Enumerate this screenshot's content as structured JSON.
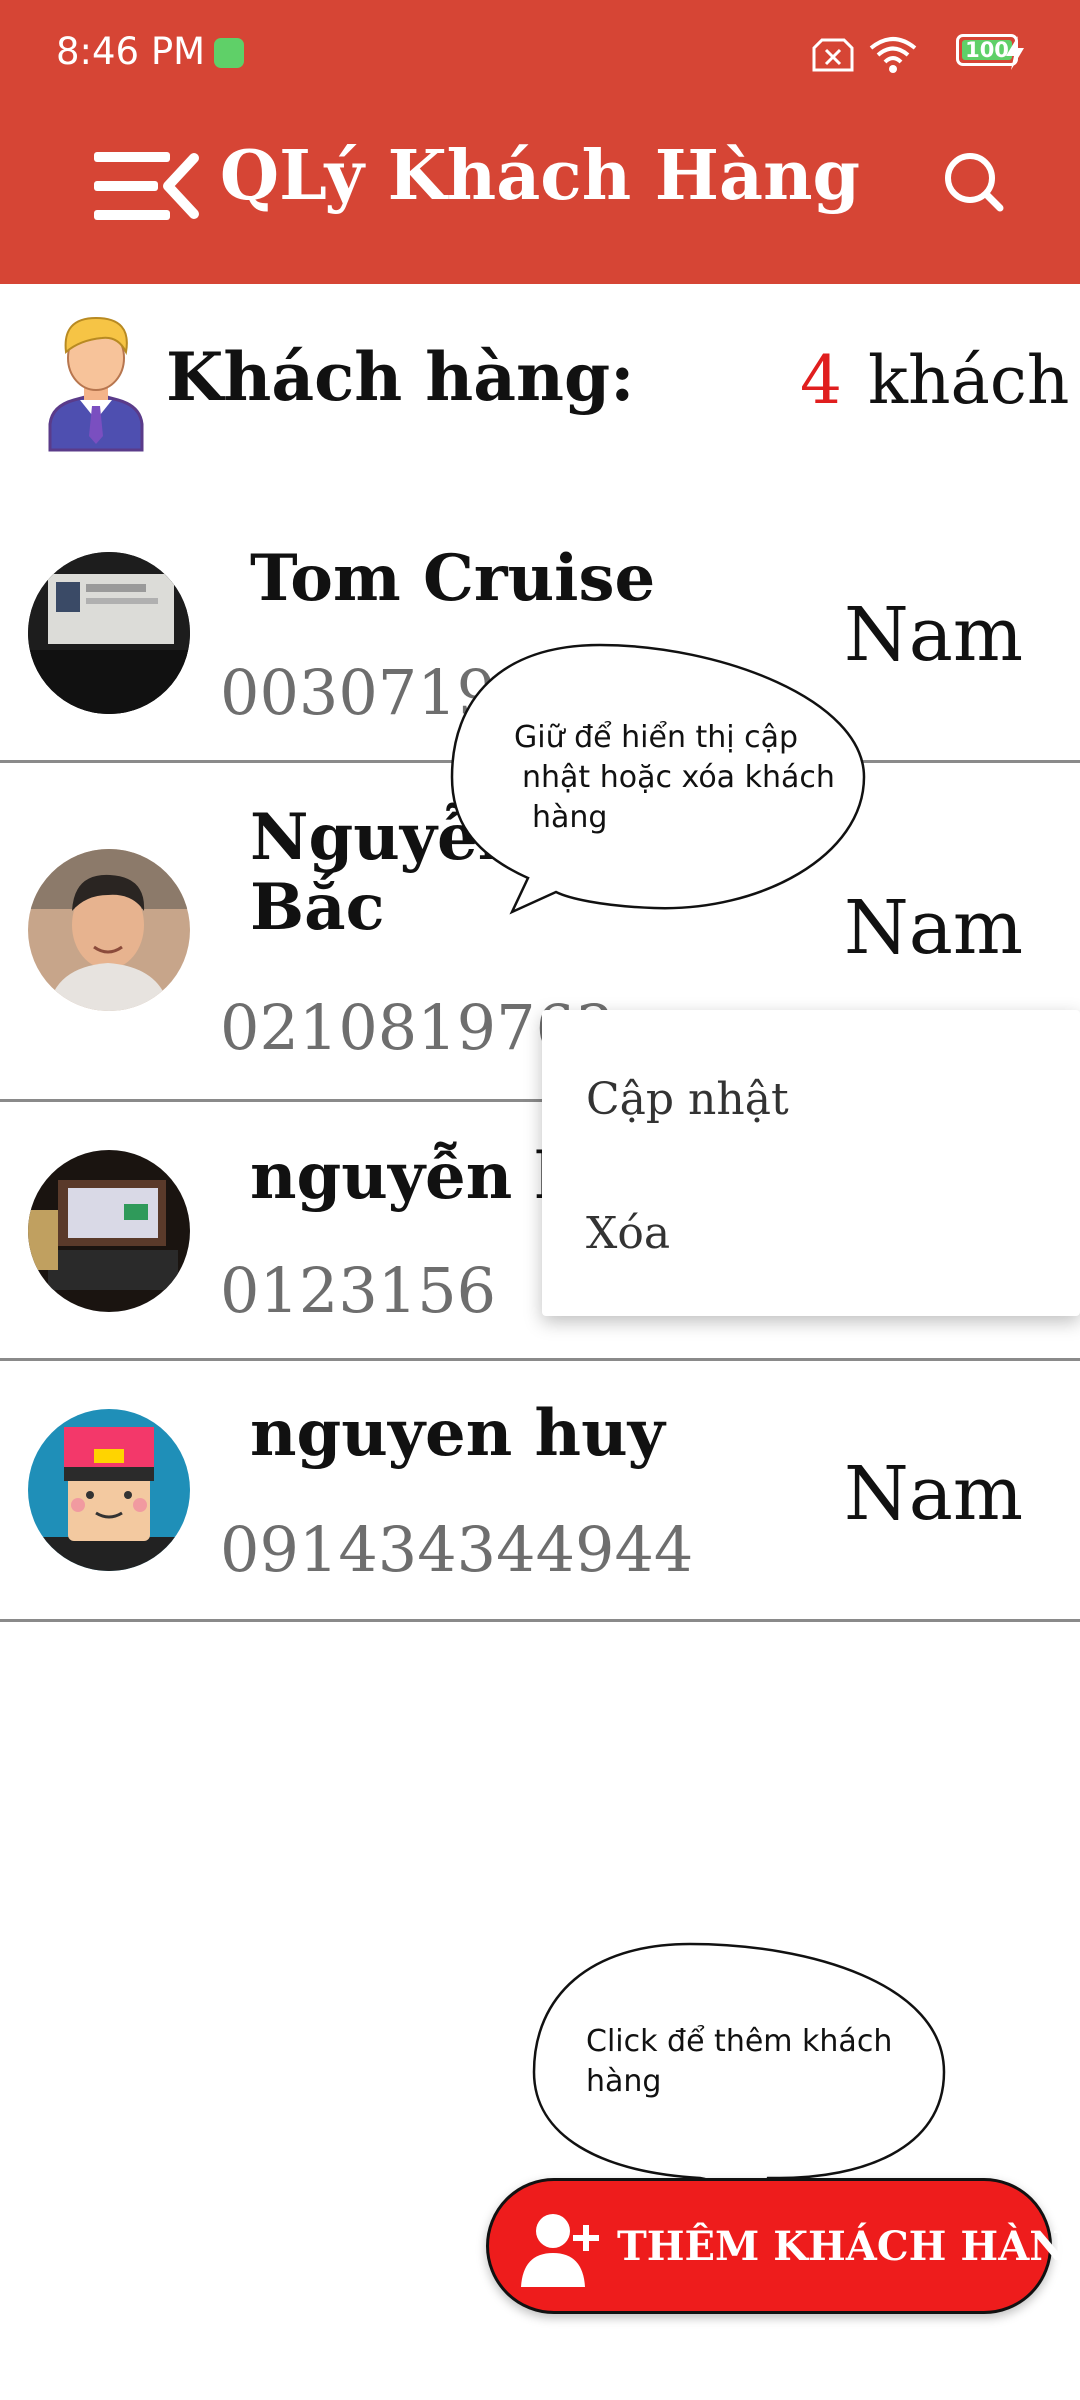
{
  "status_bar": {
    "time": "8:46 PM",
    "battery": "100",
    "icons": [
      "app-notification-icon",
      "sim-off-icon",
      "wifi-icon",
      "battery-icon",
      "charging-icon"
    ]
  },
  "app_bar": {
    "title": "QLý Khách Hàng",
    "menu_icon": "menu-collapse-icon",
    "search_icon": "search-icon",
    "background": "#d64535"
  },
  "header": {
    "label": "Khách hàng:",
    "count": "4",
    "unit": "khách",
    "count_color": "#e01e1e"
  },
  "customers": [
    {
      "name": "Tom Cruise",
      "phone": "0030719632",
      "gender": "Nam"
    },
    {
      "name": "Nguyễn Xuân Bắc",
      "name_line1": "Nguyễn",
      "name_line2": "Bắc",
      "phone": "0210819763",
      "gender": "Nam"
    },
    {
      "name": "nguyễn h",
      "phone": "0123156",
      "gender": ""
    },
    {
      "name": "nguyen huy",
      "phone": "091434344944",
      "gender": "Nam"
    }
  ],
  "context_menu": {
    "items": [
      {
        "label": "Cập nhật"
      },
      {
        "label": "Xóa"
      }
    ]
  },
  "tooltips": {
    "long_press": [
      "Giữ để hiển thị cập",
      "nhật hoặc xóa khách",
      "hàng"
    ],
    "add": [
      "Click để thêm khách",
      "hàng"
    ]
  },
  "fab": {
    "label": "THÊM KHÁCH HÀNG",
    "icon": "add-user-icon",
    "color": "#ee1c1c"
  }
}
